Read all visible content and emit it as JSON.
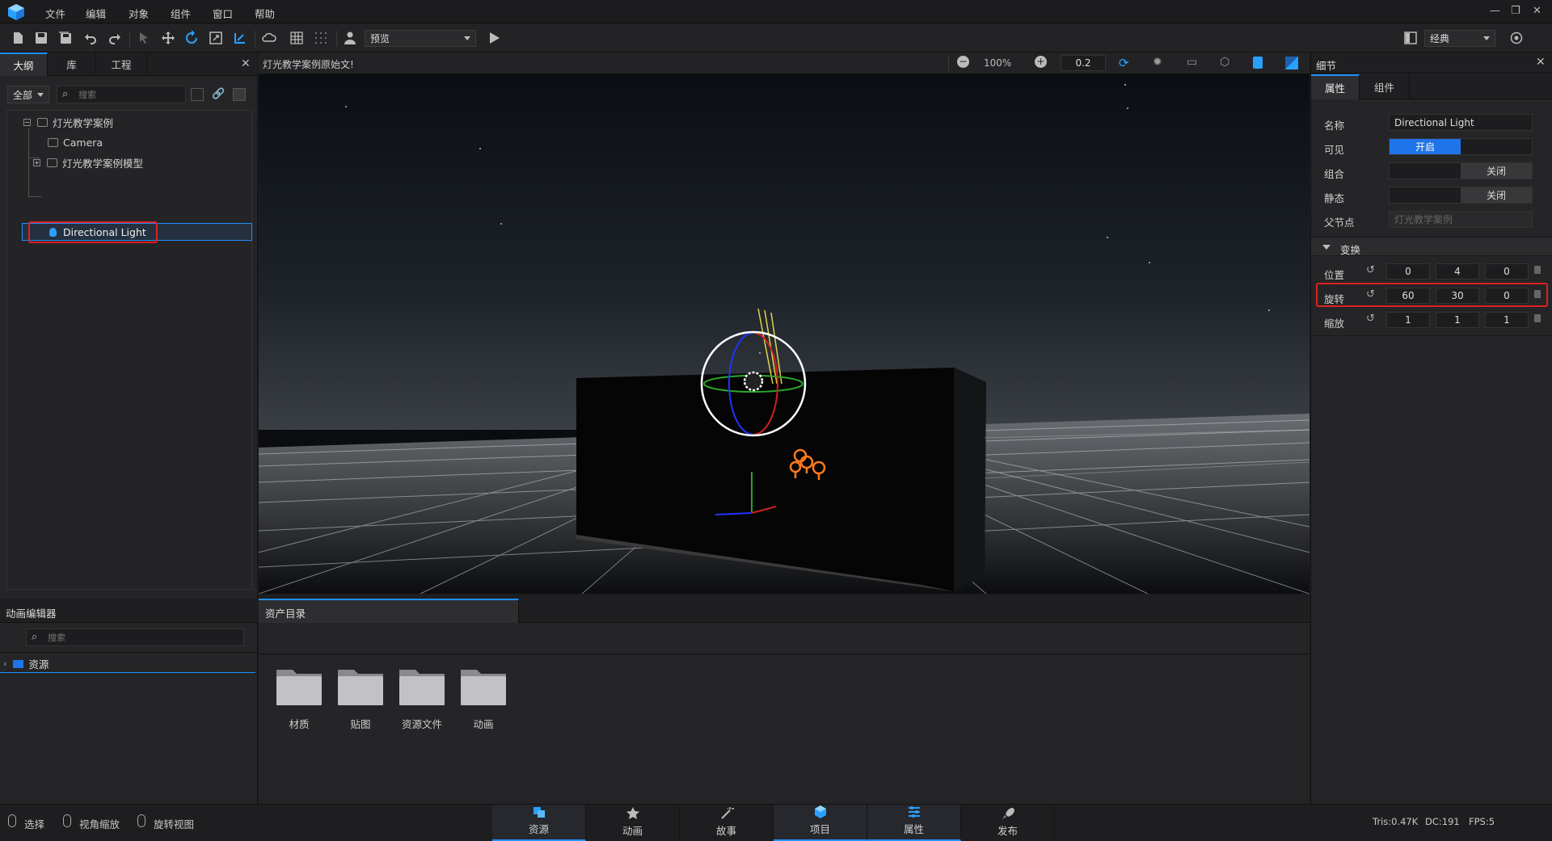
{
  "menu": {
    "items": [
      "文件",
      "编辑",
      "对象",
      "组件",
      "窗口",
      "帮助"
    ]
  },
  "toolbar": {
    "preview_label": "预览",
    "layout_label": "经典"
  },
  "left_panel": {
    "tabs": [
      "大纲",
      "库",
      "工程"
    ],
    "filter": "全部",
    "search_placeholder": "搜索",
    "tree": [
      "灯光教学案例",
      "Camera",
      "灯光教学案例模型",
      "Directional Light"
    ]
  },
  "viewport": {
    "title": "灯光教学案例原始文!",
    "zoom": "100%",
    "snap": "0.2"
  },
  "details": {
    "title": "细节",
    "tabs": [
      "属性",
      "组件"
    ],
    "name_label": "名称",
    "name_value": "Directional Light",
    "visible_label": "可见",
    "visible_value": "开启",
    "group_label": "组合",
    "group_value": "关闭",
    "static_label": "静态",
    "static_value": "关闭",
    "parent_label": "父节点",
    "parent_value": "灯光教学案例",
    "transform_label": "变换",
    "position_label": "位置",
    "position": [
      "0",
      "4",
      "0"
    ],
    "rotation_label": "旋转",
    "rotation": [
      "60",
      "30",
      "0"
    ],
    "scale_label": "缩放",
    "scale": [
      "1",
      "1",
      "1"
    ]
  },
  "anim_panel": {
    "title": "动画编辑器",
    "search_placeholder": "搜索",
    "root": "资源"
  },
  "assets": {
    "tab": "资产目录",
    "folders": [
      "材质",
      "贴图",
      "资源文件",
      "动画"
    ]
  },
  "status": {
    "tools": [
      "选择",
      "视角缩放",
      "旋转视图"
    ],
    "tabs": [
      "资源",
      "动画",
      "故事",
      "项目",
      "属性",
      "发布"
    ],
    "tris": "Tris:0.47K",
    "dc": "DC:191",
    "fps": "FPS:5"
  },
  "colors": {
    "accent": "#1e90ff",
    "highlight": "#e02020",
    "light_icon": "#ff7a1a"
  }
}
